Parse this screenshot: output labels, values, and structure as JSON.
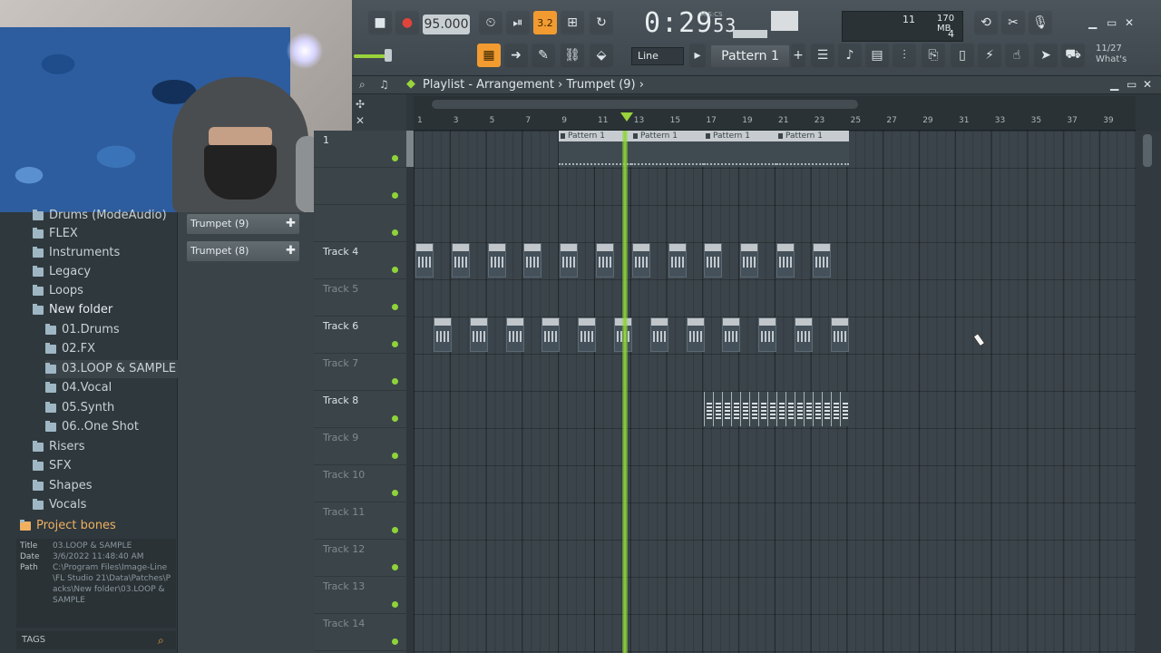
{
  "toolbar": {
    "tempo": "95.000",
    "time": "0:29",
    "time_frac": "53",
    "time_label": "M:S:CS",
    "mode_label": "3.2",
    "cpu_top": "11",
    "ram": "170 MB",
    "cpu_bottom": "4",
    "snap": "Line",
    "pattern": "Pattern 1",
    "hint": "11/27\nWhat's"
  },
  "playlist": {
    "title": "Playlist - Arrangement",
    "current": "Trumpet (9)",
    "ruler": [
      "1",
      "3",
      "5",
      "7",
      "9",
      "11",
      "13",
      "15",
      "17",
      "19",
      "21",
      "23",
      "25",
      "27",
      "29",
      "31",
      "33",
      "35",
      "37",
      "39"
    ],
    "tracks": [
      {
        "label": "1",
        "dim": false
      },
      {
        "label": "",
        "dim": true
      },
      {
        "label": "",
        "dim": true
      },
      {
        "label": "Track 4",
        "dim": false
      },
      {
        "label": "Track 5",
        "dim": true
      },
      {
        "label": "Track 6",
        "dim": false
      },
      {
        "label": "Track 7",
        "dim": true
      },
      {
        "label": "Track 8",
        "dim": false
      },
      {
        "label": "Track 9",
        "dim": true
      },
      {
        "label": "Track 10",
        "dim": true
      },
      {
        "label": "Track 11",
        "dim": true
      },
      {
        "label": "Track 12",
        "dim": true
      },
      {
        "label": "Track 13",
        "dim": true
      },
      {
        "label": "Track 14",
        "dim": true
      }
    ],
    "patterns": [
      "Pattern 1",
      "Pattern 1",
      "Pattern 1",
      "Pattern 1"
    ]
  },
  "browser": {
    "items": [
      {
        "label": "Drums (ModeAudio)",
        "sub": false
      },
      {
        "label": "FLEX",
        "sub": false
      },
      {
        "label": "Instruments",
        "sub": false
      },
      {
        "label": "Legacy",
        "sub": false
      },
      {
        "label": "Loops",
        "sub": false
      },
      {
        "label": "New folder",
        "sub": false,
        "bold": true
      },
      {
        "label": "01.Drums",
        "sub": true
      },
      {
        "label": "02.FX",
        "sub": true
      },
      {
        "label": "03.LOOP & SAMPLE",
        "sub": true,
        "selected": true
      },
      {
        "label": "04.Vocal",
        "sub": true
      },
      {
        "label": "05.Synth",
        "sub": true
      },
      {
        "label": "06..One Shot",
        "sub": true
      },
      {
        "label": "Risers",
        "sub": false
      },
      {
        "label": "SFX",
        "sub": false
      },
      {
        "label": "Shapes",
        "sub": false
      },
      {
        "label": "Vocals",
        "sub": false
      }
    ],
    "project_bones": "Project bones",
    "info": {
      "title_key": "Title",
      "title_val": "03.LOOP & SAMPLE",
      "date_key": "Date",
      "date_val": "3/6/2022 11:48:40 AM",
      "path_key": "Path",
      "path_val": "C:\\Program Files\\Image-Line\\FL Studio 21\\Data\\Patches\\Packs\\New folder\\03.LOOP & SAMPLE"
    },
    "tags": "TAGS"
  },
  "picker": {
    "items": [
      "Trumpet (9)",
      "Trumpet (8)"
    ]
  },
  "colors": {
    "accent_green": "#8ed33a",
    "accent_orange": "#f29b30"
  }
}
